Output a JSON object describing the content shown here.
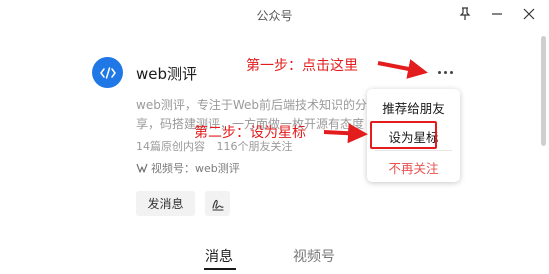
{
  "window": {
    "title": "公众号"
  },
  "icons": {
    "pin": "pin-icon",
    "minimize": "minimize-icon",
    "close": "close-icon",
    "avatar": "code-brackets-icon",
    "channel": "channels-icon",
    "sign": "signature-icon",
    "more": "more-dots-icon"
  },
  "colors": {
    "avatar_bg": "#1f78e5",
    "annotation_red": "#e31d1d",
    "danger_text": "#e8514f"
  },
  "profile": {
    "name": "web测评",
    "description": "web测评，专注于Web前后端技术知识的分享，码搭建测评，一方面做一枚开源有态度的",
    "article_count": "14篇原创内容",
    "friends_following": "116个朋友关注",
    "channel_label": "视频号：web测评"
  },
  "actions": {
    "send_message": "发消息"
  },
  "tabs": [
    {
      "label": "消息"
    },
    {
      "label": "视频号"
    }
  ],
  "menu": {
    "items": [
      {
        "label": "推荐给朋友"
      },
      {
        "label": "设为星标"
      },
      {
        "label": "不再关注"
      }
    ]
  },
  "annotations": {
    "step1": "第一步：点击这里",
    "step2": "第二步：设为星标"
  }
}
